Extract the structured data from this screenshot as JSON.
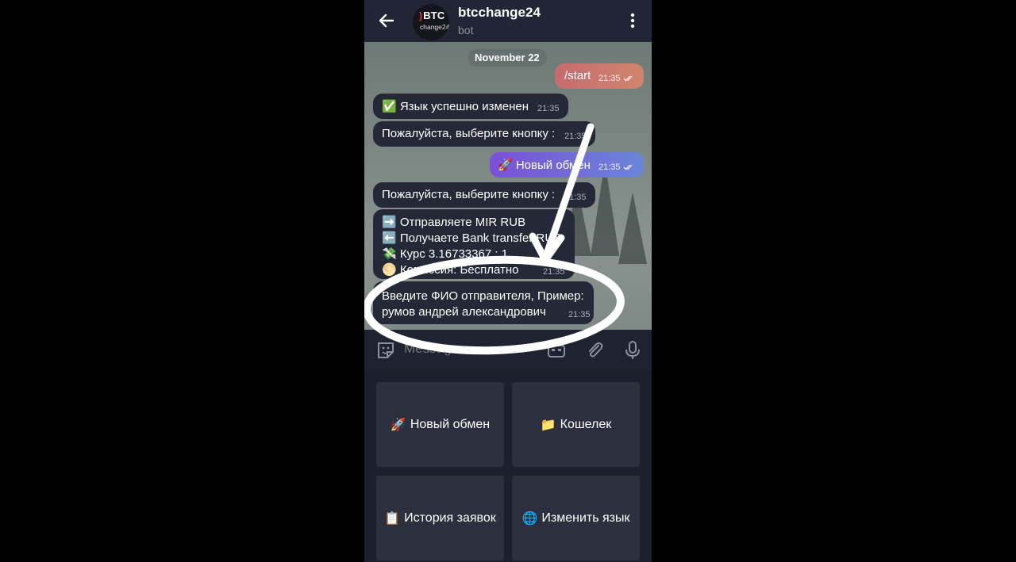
{
  "header": {
    "title": "btcchange24",
    "subtitle": "bot",
    "logo": {
      "top": "BTC",
      "bottom": "change24"
    }
  },
  "chat": {
    "date": "November 22",
    "messages": [
      {
        "text": "/start",
        "time": "21:35"
      },
      {
        "text": "✅ Язык успешно изменен",
        "time": "21:35"
      },
      {
        "text": "Пожалуйста, выберите кнопку :",
        "time": "21:35"
      },
      {
        "text": "🚀 Новый обмен",
        "time": "21:35"
      },
      {
        "text": "Пожалуйста, выберите кнопку :",
        "time": "21:35"
      },
      {
        "lines": [
          "➡️ Отправляете MIR RUB",
          "⬅️ Получаете Bank transfer RUB",
          "💸 Курс 3.16733367 : 1",
          "🌕 Комиссия: Бесплатно"
        ],
        "time": "21:35"
      },
      {
        "lines": [
          "Введите  ФИО отправителя, Пример:",
          "румов андрей александрович"
        ],
        "time": "21:35"
      }
    ]
  },
  "input": {
    "placeholder": "Message"
  },
  "keyboard": {
    "buttons": [
      {
        "emoji": "🚀",
        "label": "Новый обмен"
      },
      {
        "emoji": "📁",
        "label": "Кошелек"
      },
      {
        "emoji": "📋",
        "label": "История заявок"
      },
      {
        "emoji": "🌐",
        "label": "Изменить язык"
      }
    ]
  },
  "colors": {
    "incoming_bubble": "#252837",
    "outgoing_start": "#c66b6e",
    "outgoing_exchange": "#7a4fd6",
    "keyboard_button": "#2c2f3e",
    "header": "#222535"
  }
}
